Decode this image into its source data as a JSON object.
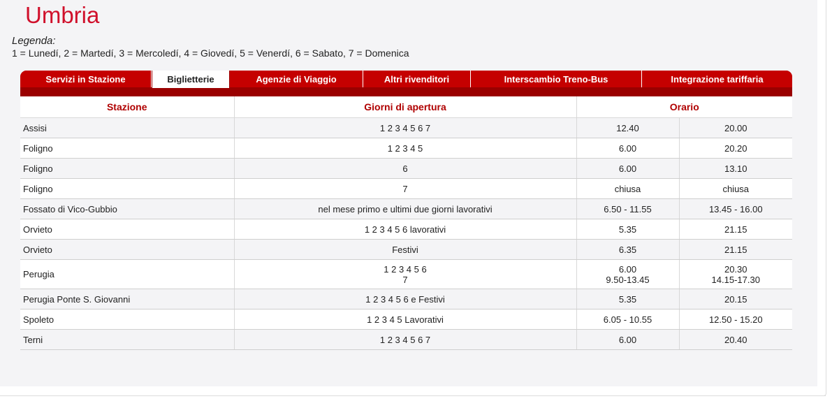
{
  "page": {
    "title": "Umbria",
    "legend_title": "Legenda:",
    "legend_text": "1 = Lunedí, 2 = Martedí, 3 = Mercoledí, 4 = Giovedí, 5 = Venerdí, 6 = Sabato, 7 = Domenica"
  },
  "tabs": [
    {
      "label": "Servizi in Stazione",
      "active": false
    },
    {
      "label": "Biglietterie",
      "active": true
    },
    {
      "label": "Agenzie di Viaggio",
      "active": false
    },
    {
      "label": "Altri rivenditori",
      "active": false
    },
    {
      "label": "Interscambio Treno-Bus",
      "active": false
    },
    {
      "label": "Integrazione tariffaria",
      "active": false
    }
  ],
  "table": {
    "headers": {
      "stazione": "Stazione",
      "giorni": "Giorni di apertura",
      "orario": "Orario"
    },
    "rows": [
      {
        "stazione": "Assisi",
        "giorni": "1 2 3 4 5 6 7",
        "open": "12.40",
        "close": "20.00"
      },
      {
        "stazione": "Foligno",
        "giorni": "1 2 3 4 5",
        "open": "6.00",
        "close": "20.20"
      },
      {
        "stazione": "Foligno",
        "giorni": "6",
        "open": "6.00",
        "close": "13.10"
      },
      {
        "stazione": "Foligno",
        "giorni": "7",
        "open": "chiusa",
        "close": "chiusa"
      },
      {
        "stazione": "Fossato di Vico-Gubbio",
        "giorni": "nel mese primo e ultimi due giorni lavorativi",
        "open": "6.50 - 11.55",
        "close": "13.45 - 16.00"
      },
      {
        "stazione": "Orvieto",
        "giorni": "1 2 3 4 5 6 lavorativi",
        "open": "5.35",
        "close": "21.15"
      },
      {
        "stazione": "Orvieto",
        "giorni": "Festivi",
        "open": "6.35",
        "close": "21.15"
      },
      {
        "stazione": "Perugia",
        "giorni": "1 2 3 4 5 6",
        "giorni2": "7",
        "open": "6.00",
        "open2": "9.50-13.45",
        "close": "20.30",
        "close2": "14.15-17.30"
      },
      {
        "stazione": "Perugia Ponte S. Giovanni",
        "giorni": "1 2 3 4 5 6 e Festivi",
        "open": "5.35",
        "close": "20.15"
      },
      {
        "stazione": "Spoleto",
        "giorni": "1 2 3 4 5 Lavorativi",
        "open": "6.05 - 10.55",
        "close": "12.50 - 15.20"
      },
      {
        "stazione": "Terni",
        "giorni": "1 2 3 4 5 6 7",
        "open": "6.00",
        "close": "20.40"
      }
    ]
  }
}
